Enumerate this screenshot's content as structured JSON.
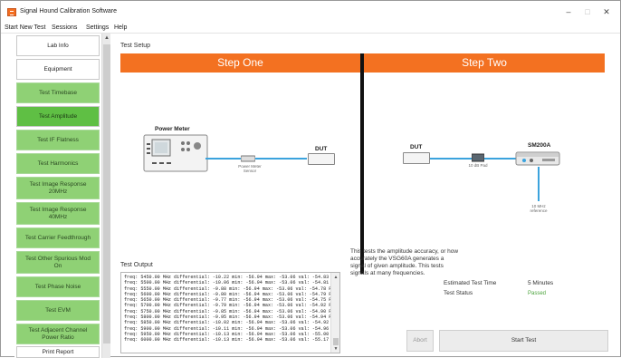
{
  "window": {
    "title": "Signal Hound Calibration Software",
    "controls": {
      "minimize": "–",
      "maximize": "□",
      "close": "✕"
    }
  },
  "menu": [
    "Start New Test",
    "Sessions",
    "Settings",
    "Help"
  ],
  "sidebar": {
    "items": [
      {
        "label": "Lab Info",
        "style": "white"
      },
      {
        "label": "Equipment",
        "style": "white"
      },
      {
        "label": "Test Timebase",
        "style": "green"
      },
      {
        "label": "Test Amplitude",
        "style": "active"
      },
      {
        "label": "Test IF Flatness",
        "style": "green"
      },
      {
        "label": "Test Harmonics",
        "style": "green"
      },
      {
        "label": "Test Image Response 20MHz",
        "style": "green"
      },
      {
        "label": "Test Image Response 40MHz",
        "style": "green"
      },
      {
        "label": "Test Carrier Feedthrough",
        "style": "green"
      },
      {
        "label": "Test Other Spurious Mod On",
        "style": "green"
      },
      {
        "label": "Test Phase Noise",
        "style": "green"
      },
      {
        "label": "Test EVM",
        "style": "green"
      },
      {
        "label": "Test Adjacent Channel Power Ratio",
        "style": "green"
      },
      {
        "label": "Print Report",
        "style": "white"
      }
    ]
  },
  "test_setup": {
    "label": "Test Setup",
    "step_one": "Step One",
    "step_two": "Step Two",
    "power_meter_label": "Power Meter",
    "power_meter_sensor": "Power Meter Sensor",
    "dut_label": "DUT",
    "dut2_label": "DUT",
    "sm200a_label": "SM200A",
    "pad_caption": "10 dB Pad",
    "ref_caption": "10 MHz reference",
    "accent_color": "#f37121",
    "cable_color": "#3ba3dd"
  },
  "test_output": {
    "label": "Test Output",
    "lines": [
      "freq: 5450.00 MHz differential: -10.22 min: -56.94 max: -53.06 val: -54.83 PASS",
      "freq: 5500.00 MHz differential: -10.06 min: -56.94 max: -53.06 val: -54.81 PASS",
      "freq: 5550.00 MHz differential: -9.88 min: -56.94 max: -53.06 val: -54.78 PASS",
      "freq: 5600.00 MHz differential: -9.80 min: -56.94 max: -53.06 val: -54.79 PASS",
      "freq: 5650.00 MHz differential: -9.77 min: -56.94 max: -53.06 val: -54.75 PASS",
      "freq: 5700.00 MHz differential: -9.79 min: -56.94 max: -53.06 val: -54.92 PASS",
      "freq: 5750.00 MHz differential: -9.85 min: -56.94 max: -53.06 val: -54.90 PASS",
      "freq: 5800.00 MHz differential: -9.95 min: -56.94 max: -53.06 val: -54.94 PASS",
      "freq: 5850.00 MHz differential: -10.02 min: -56.94 max: -53.06 val: -54.92 PASS",
      "freq: 5900.00 MHz differential: -10.11 min: -56.94 max: -53.06 val: -54.96 PASS",
      "freq: 5950.00 MHz differential: -10.13 min: -56.94 max: -53.06 val: -55.00 PASS",
      "freq: 6000.00 MHz differential: -10.13 min: -56.94 max: -53.06 val: -55.17 PASS"
    ]
  },
  "description": "This tests the amplitude accuracy, or how accurately the VSG60A generates a signal of given amplitude. This tests signals at many frequencies.",
  "info": {
    "est_time_label": "Estimated Test Time",
    "est_time_value": "5 Minutes",
    "status_label": "Test Status",
    "status_value": "Passed",
    "status_color": "#4aa23a"
  },
  "buttons": {
    "abort": "Abort",
    "start": "Start Test"
  }
}
